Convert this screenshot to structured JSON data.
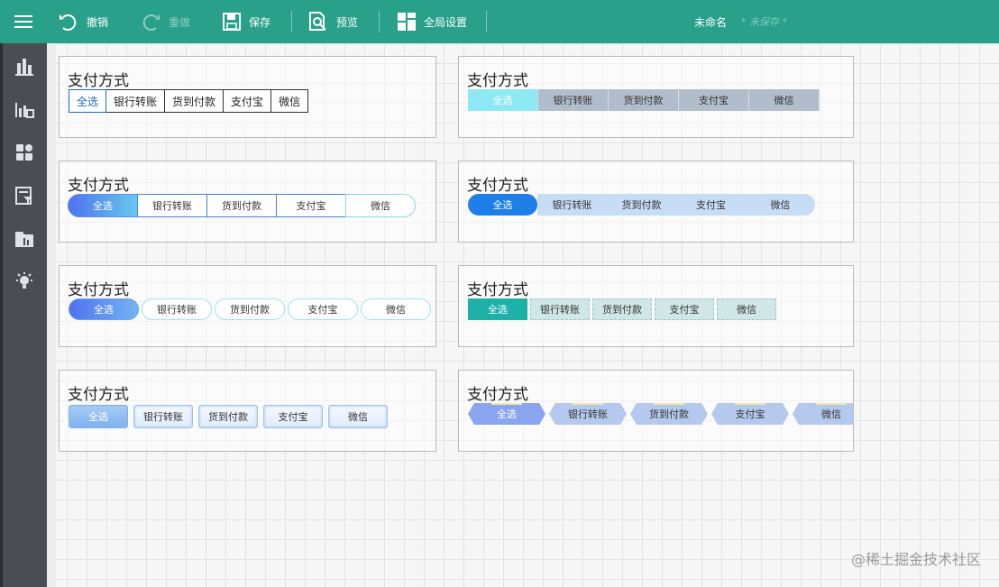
{
  "toolbar": {
    "undo": "撤销",
    "redo": "重做",
    "save": "保存",
    "preview": "预览",
    "global_settings": "全局设置",
    "doc_name": "未命名",
    "doc_status": "* 未保存 *"
  },
  "sidebar": {
    "items": [
      {
        "icon": "bar-chart-icon"
      },
      {
        "icon": "chart-data-icon"
      },
      {
        "icon": "grid-icon"
      },
      {
        "icon": "filter-form-icon"
      },
      {
        "icon": "report-icon"
      },
      {
        "icon": "lightbulb-icon"
      }
    ]
  },
  "cards": [
    {
      "title": "支付方式",
      "tabs": [
        "全选",
        "银行转账",
        "货到付款",
        "支付宝",
        "微信"
      ],
      "active": 0
    },
    {
      "title": "支付方式",
      "tabs": [
        "全选",
        "银行转账",
        "货到付款",
        "支付宝",
        "微信"
      ],
      "active": 0
    },
    {
      "title": "支付方式",
      "tabs": [
        "全选",
        "银行转账",
        "货到付款",
        "支付宝",
        "微信"
      ],
      "active": 0
    },
    {
      "title": "支付方式",
      "tabs": [
        "全选",
        "银行转账",
        "货到付款",
        "支付宝",
        "微信"
      ],
      "active": 0
    },
    {
      "title": "支付方式",
      "tabs": [
        "全选",
        "银行转账",
        "货到付款",
        "支付宝",
        "微信"
      ],
      "active": 0
    },
    {
      "title": "支付方式",
      "tabs": [
        "全选",
        "银行转账",
        "货到付款",
        "支付宝",
        "微信"
      ],
      "active": 0
    },
    {
      "title": "支付方式",
      "tabs": [
        "全选",
        "银行转账",
        "货到付款",
        "支付宝",
        "微信"
      ],
      "active": 0
    },
    {
      "title": "支付方式",
      "tabs": [
        "全选",
        "银行转账",
        "货到付款",
        "支付宝",
        "微信"
      ],
      "active": 0
    }
  ],
  "watermark": "@稀土掘金技术社区",
  "colors": {
    "topbar": "#29a08a",
    "sidebar": "#4a4d52",
    "accent_blue": "#1e66d0"
  }
}
